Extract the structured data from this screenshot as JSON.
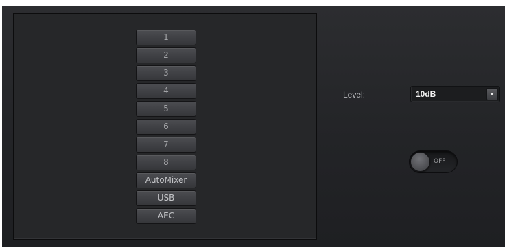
{
  "channels": [
    {
      "label": "1"
    },
    {
      "label": "2"
    },
    {
      "label": "3"
    },
    {
      "label": "4"
    },
    {
      "label": "5"
    },
    {
      "label": "6"
    },
    {
      "label": "7"
    },
    {
      "label": "8"
    },
    {
      "label": "AutoMixer"
    },
    {
      "label": "USB"
    },
    {
      "label": "AEC"
    }
  ],
  "level": {
    "label": "Level:",
    "value": "10dB"
  },
  "toggle": {
    "state_label": "OFF",
    "on": false
  },
  "colors": {
    "background": "#232427",
    "panel": "#262729",
    "button": "#3f4044",
    "text": "#b6b7ba"
  },
  "icons": {
    "dropdown": "chevron-down-icon"
  }
}
